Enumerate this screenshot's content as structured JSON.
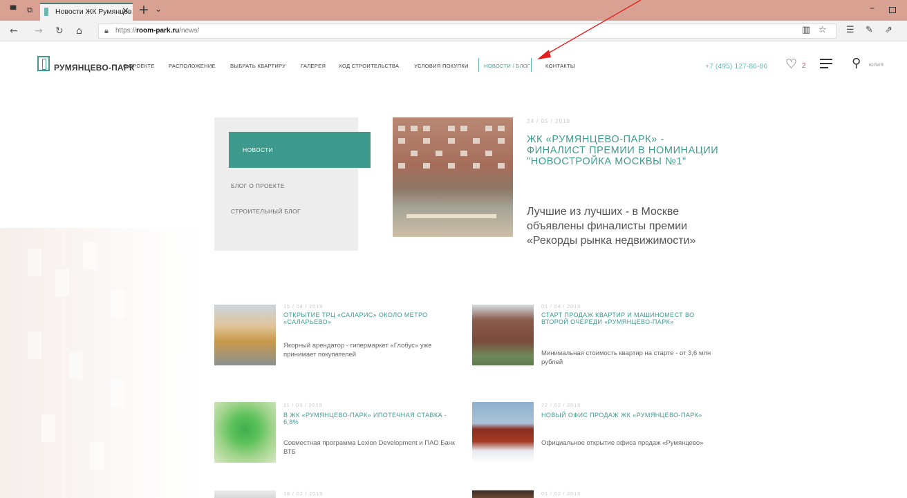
{
  "browser": {
    "tab_title": "Новости ЖК Румянцев",
    "url_prefix": "https://",
    "url_domain": "room-park.ru",
    "url_path": "/news/"
  },
  "site": {
    "logo_text": "РУМЯНЦЕВО-ПАРК",
    "nav": [
      {
        "label": "О ПРОЕКТЕ"
      },
      {
        "label": "РАСПОЛОЖЕНИЕ"
      },
      {
        "label": "ВЫБРАТЬ КВАРТИРУ"
      },
      {
        "label": "ГАЛЕРЕЯ"
      },
      {
        "label": "ХОД СТРОИТЕЛЬСТВА"
      },
      {
        "label": "УСЛОВИЯ ПОКУПКИ"
      },
      {
        "label": "НОВОСТИ / БЛОГ"
      },
      {
        "label": "КОНТАКТЫ"
      }
    ],
    "phone": "+7 (495) 127-86-86",
    "favorites_count": "2",
    "user_name": "ЮЛИЯ",
    "accent_color": "#3f9a8e"
  },
  "side_menu": {
    "items": [
      {
        "label": "НОВОСТИ"
      },
      {
        "label": "БЛОГ О ПРОЕКТЕ"
      },
      {
        "label": "СТРОИТЕЛЬНЫЙ БЛОГ"
      }
    ]
  },
  "featured": {
    "date": "24 / 05 / 2019",
    "title": "ЖК «РУМЯНЦЕВО-ПАРК» - ФИНАЛИСТ ПРЕМИИ В НОМИНАЦИИ \"НОВОСТРОЙКА МОСКВЫ №1\"",
    "desc": "Лучшие из лучших - в Москве объявлены финалисты премии «Рекорды рынка недвижимости»"
  },
  "news": [
    {
      "date": "15 / 04 / 2019",
      "title": "ОТКРЫТИЕ ТРЦ «САЛАРИС» ОКОЛО МЕТРО «САЛАРЬЕВО»",
      "desc": "Якорный арендатор - гипермаркет «Глобус» уже принимает покупателей"
    },
    {
      "date": "01 / 04 / 2019",
      "title": "СТАРТ ПРОДАЖ КВАРТИР И МАШИНОМЕСТ ВО ВТОРОЙ ОЧЕРЕДИ «РУМЯНЦЕВО-ПАРК»",
      "desc": "Минимальная стоимость квартир на старте - от 3,6 млн рублей"
    },
    {
      "date": "11 / 03 / 2019",
      "title": "В ЖК «РУМЯНЦЕВО-ПАРК» ИПОТЕЧНАЯ СТАВКА - 6,8%",
      "desc": "Совместная программа Lexion Development и ПАО Банк ВТБ"
    },
    {
      "date": "22 / 02 / 2019",
      "title": "НОВЫЙ ОФИС ПРОДАЖ ЖК «РУМЯНЦЕВО-ПАРК»",
      "desc": "Официальное открытие офиса продаж «Румянцево»"
    },
    {
      "date": "18 / 02 / 2019"
    },
    {
      "date": "01 / 02 / 2019"
    }
  ]
}
